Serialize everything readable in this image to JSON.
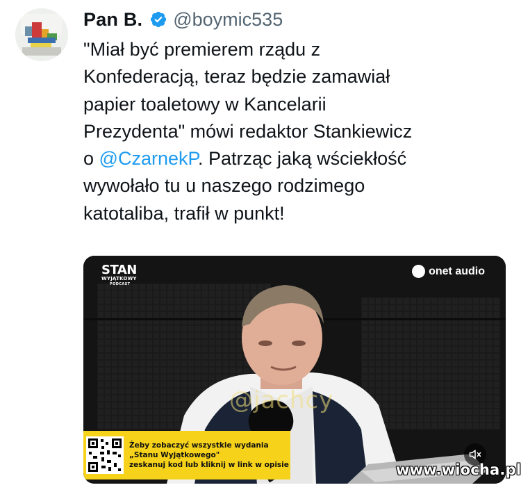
{
  "tweet": {
    "author_name": "Pan B.",
    "handle": "@boymic535",
    "text_lines": [
      "\"Miał być premierem rządu z",
      "Konfederacją, teraz będzie zamawiał",
      "papier toaletowy w Kancelarii",
      "Prezydenta\" mówi redaktor Stankiewicz"
    ],
    "line5_prefix": "o ",
    "mention": "@CzarnekP",
    "line5_suffix": ". Patrząc jaką wściekłość",
    "text_lines_end": [
      "wywołało tu u naszego rodzimego",
      "katotaliba, trafił w punkt!"
    ]
  },
  "media": {
    "logo_line1": "STAN",
    "logo_line2": "WYJĄTKOWY",
    "logo_line3": "PODCAST",
    "brand": "onet audio",
    "overlay_watermark": "@jachcy",
    "promo_line1": "Żeby zobaczyć wszystkie wydania",
    "promo_line2": "„Stanu Wyjątkowego\"",
    "promo_line3": "zeskanuj kod lub kliknij w link w opisie",
    "mute_icon": "muted-speaker-icon"
  },
  "site_watermark": "www.wiocha.pl",
  "colors": {
    "accent": "#1d9bf0",
    "text": "#0f1419",
    "secondary": "#536471",
    "promo_bg": "#f6d21a"
  }
}
